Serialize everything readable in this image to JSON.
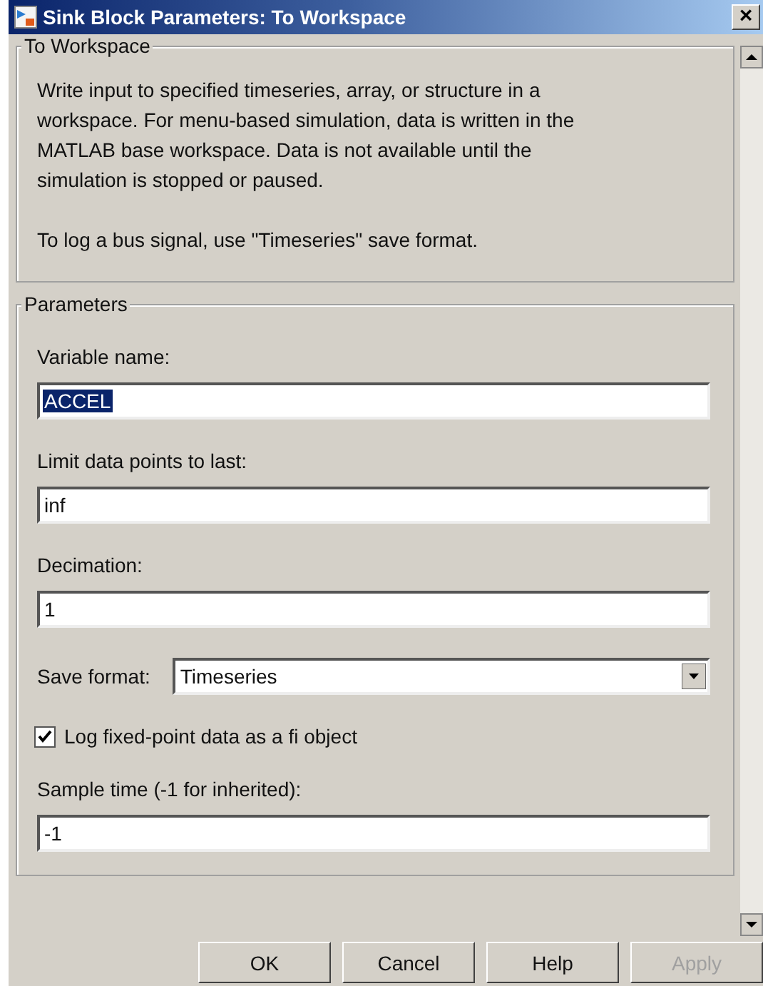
{
  "window": {
    "title": "Sink Block Parameters: To Workspace",
    "close": "×"
  },
  "description": {
    "title": "To Workspace",
    "paragraphs": [
      "Write input to specified timeseries, array, or structure in a workspace. For menu-based simulation, data is written in the MATLAB base workspace. Data is not available until the simulation is stopped or paused.",
      "To log a bus signal, use \"Timeseries\" save format."
    ]
  },
  "parameters": {
    "title": "Parameters",
    "items": [
      {
        "kind": "text",
        "label": "Variable name:",
        "value": "ACCEL",
        "highlighted": true
      },
      {
        "kind": "text",
        "label": "Limit data points to last:",
        "value": "inf",
        "highlighted": false
      },
      {
        "kind": "text",
        "label": "Decimation:",
        "value": "1",
        "highlighted": false
      },
      {
        "kind": "dropdown",
        "label": "Save format:",
        "value": "Timeseries"
      },
      {
        "kind": "checkbox",
        "label": "Log fixed-point data as a fi object",
        "checked": true
      },
      {
        "kind": "text",
        "label": "Sample time (-1 for inherited):",
        "value": "-1",
        "highlighted": false
      }
    ]
  },
  "buttons": [
    {
      "label": "OK",
      "disabled": false
    },
    {
      "label": "Cancel",
      "disabled": false
    },
    {
      "label": "Help",
      "disabled": false
    },
    {
      "label": "Apply",
      "disabled": true
    }
  ]
}
